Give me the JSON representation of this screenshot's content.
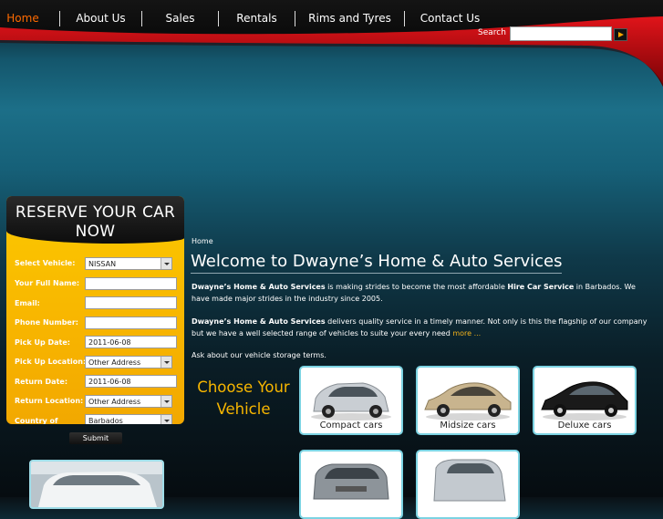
{
  "nav": {
    "items": [
      {
        "label": "Home",
        "active": true
      },
      {
        "label": "About Us"
      },
      {
        "label": "Sales"
      },
      {
        "label": "Rentals"
      },
      {
        "label": "Rims and Tyres"
      },
      {
        "label": "Contact Us"
      }
    ]
  },
  "search": {
    "label": "Search",
    "value": ""
  },
  "reserve": {
    "title": "RESERVE YOUR CAR NOW",
    "fields": [
      {
        "label": "Select Vehicle:",
        "value": "NISSAN",
        "type": "select"
      },
      {
        "label": "Your Full Name:",
        "value": "",
        "type": "text"
      },
      {
        "label": "Email:",
        "value": "",
        "type": "text"
      },
      {
        "label": "Phone Number:",
        "value": "",
        "type": "text"
      },
      {
        "label": "Pick Up Date:",
        "value": "2011-06-08",
        "type": "text"
      },
      {
        "label": "Pick Up Location:",
        "value": "Other Address",
        "type": "select"
      },
      {
        "label": "Return Date:",
        "value": "2011-06-08",
        "type": "text"
      },
      {
        "label": "Return Location:",
        "value": "Other Address",
        "type": "select"
      },
      {
        "label": "Country of Origin:",
        "value": "Barbados",
        "type": "select"
      }
    ],
    "submit_label": "Submit"
  },
  "breadcrumb": "Home",
  "main": {
    "title": "Welcome to Dwayne’s Home & Auto Services",
    "para1_brand": "Dwayne’s Home & Auto Services",
    "para1_a": " is making strides to become the most affordable ",
    "para1_hire": "Hire Car Service",
    "para1_b": " in Barbados. We have made major strides in the industry since 2005.",
    "para2_brand": "Dwayne’s Home & Auto Services",
    "para2_a": " delivers quality service in a timely manner. Not only is this the flagship of our company but we have a well selected range of vehicles to suite your every need ",
    "para2_more": "more ...",
    "storage": "Ask about our vehicle storage terms.",
    "choose_title": "Choose Your Vehicle"
  },
  "vehicles": [
    {
      "caption": "Compact cars",
      "color": "#c9ced3"
    },
    {
      "caption": "Midsize cars",
      "color": "#c8b48e"
    },
    {
      "caption": "Deluxe cars",
      "color": "#1a1a1a"
    },
    {
      "caption": "",
      "color": "#8d949a"
    },
    {
      "caption": "",
      "color": "#c3c9cf"
    }
  ],
  "colors": {
    "accent": "#f7b600",
    "active_nav": "#ff6a00",
    "tile_border": "#7cd3e2",
    "brand_red": "#c3070b"
  }
}
